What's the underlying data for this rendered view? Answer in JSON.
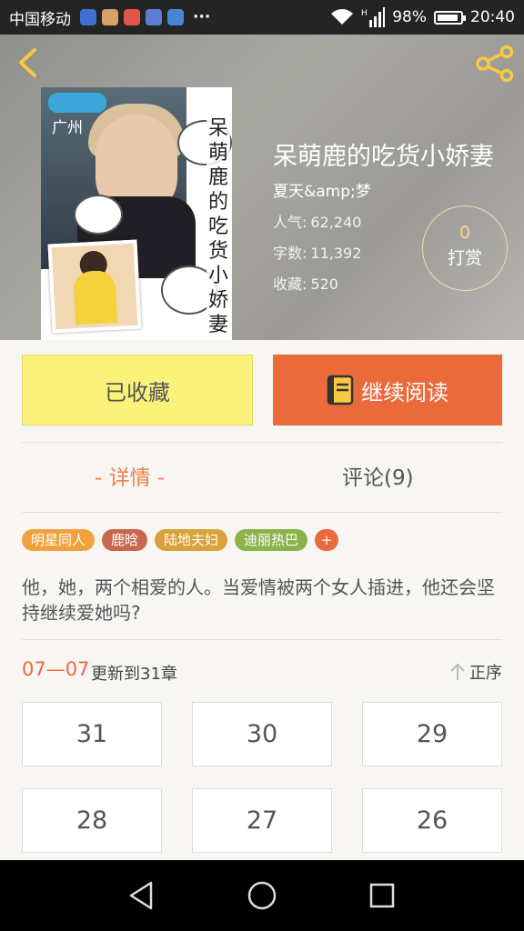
{
  "status_bar": {
    "carrier": "中国移动",
    "battery": "98%",
    "time": "20:40",
    "dots": "···"
  },
  "book": {
    "title": "呆萌鹿的吃货小娇妻",
    "author": "夏天&amp;梦",
    "stats": [
      {
        "label": "人气:",
        "value": "62,240"
      },
      {
        "label": "字数:",
        "value": "11,392"
      },
      {
        "label": "收藏:",
        "value": "520"
      }
    ],
    "reward": {
      "count": "0",
      "label": "打赏"
    },
    "cover": {
      "title_vertical": "呆萌鹿的吃货小娇妻",
      "city": "广州"
    }
  },
  "actions": {
    "collect_label": "已收藏",
    "read_label": "继续阅读"
  },
  "tabs": {
    "detail": "- 详情 -",
    "comments": "评论(9)"
  },
  "tags": [
    {
      "label": "明星同人",
      "color": "#f0a23c"
    },
    {
      "label": "鹿晗",
      "color": "#c8684f"
    },
    {
      "label": "陆地夫妇",
      "color": "#d9a23a"
    },
    {
      "label": "迪丽热巴",
      "color": "#8ab34a"
    },
    {
      "label": "+",
      "color": "#ea6a3c"
    }
  ],
  "synopsis": "他，她，两个相爱的人。当爱情被两个女人插进，他还会坚持继续爱她吗?",
  "update": {
    "date": "07—07",
    "text": "更新到31章",
    "sort_label": "正序"
  },
  "chapters": [
    "31",
    "30",
    "29",
    "28",
    "27",
    "26"
  ]
}
